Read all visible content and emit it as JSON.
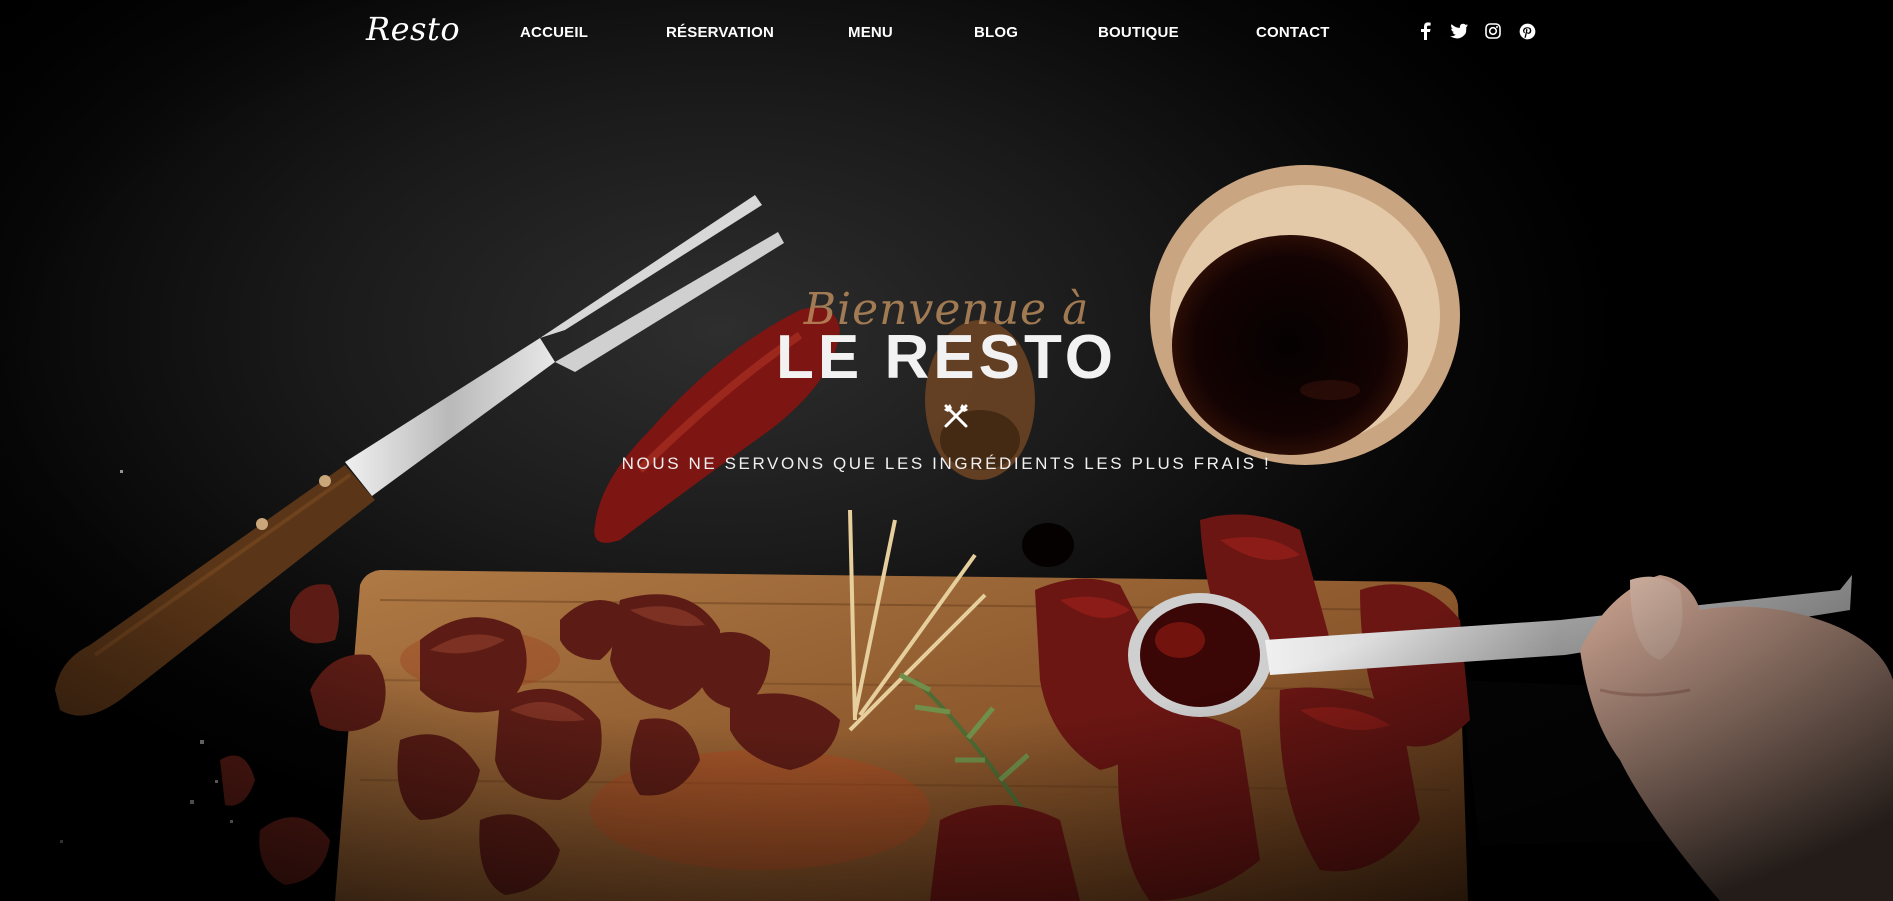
{
  "nav": {
    "logo": "Resto",
    "links": [
      "ACCUEIL",
      "RÉSERVATION",
      "MENU",
      "BLOG",
      "BOUTIQUE",
      "CONTACT"
    ],
    "social_icons": [
      "facebook-icon",
      "twitter-icon",
      "instagram-icon",
      "pinterest-icon"
    ]
  },
  "hero": {
    "welcome": "Bienvenue à",
    "title": "LE RESTO",
    "divider_icon": "fork-knife-icon",
    "subtitle": "NOUS NE SERVONS QUE LES INGRÉDIENTS LES PLUS FRAIS !"
  },
  "colors": {
    "background": "#000000",
    "accent": "#b88a5c",
    "text": "#ffffff"
  }
}
